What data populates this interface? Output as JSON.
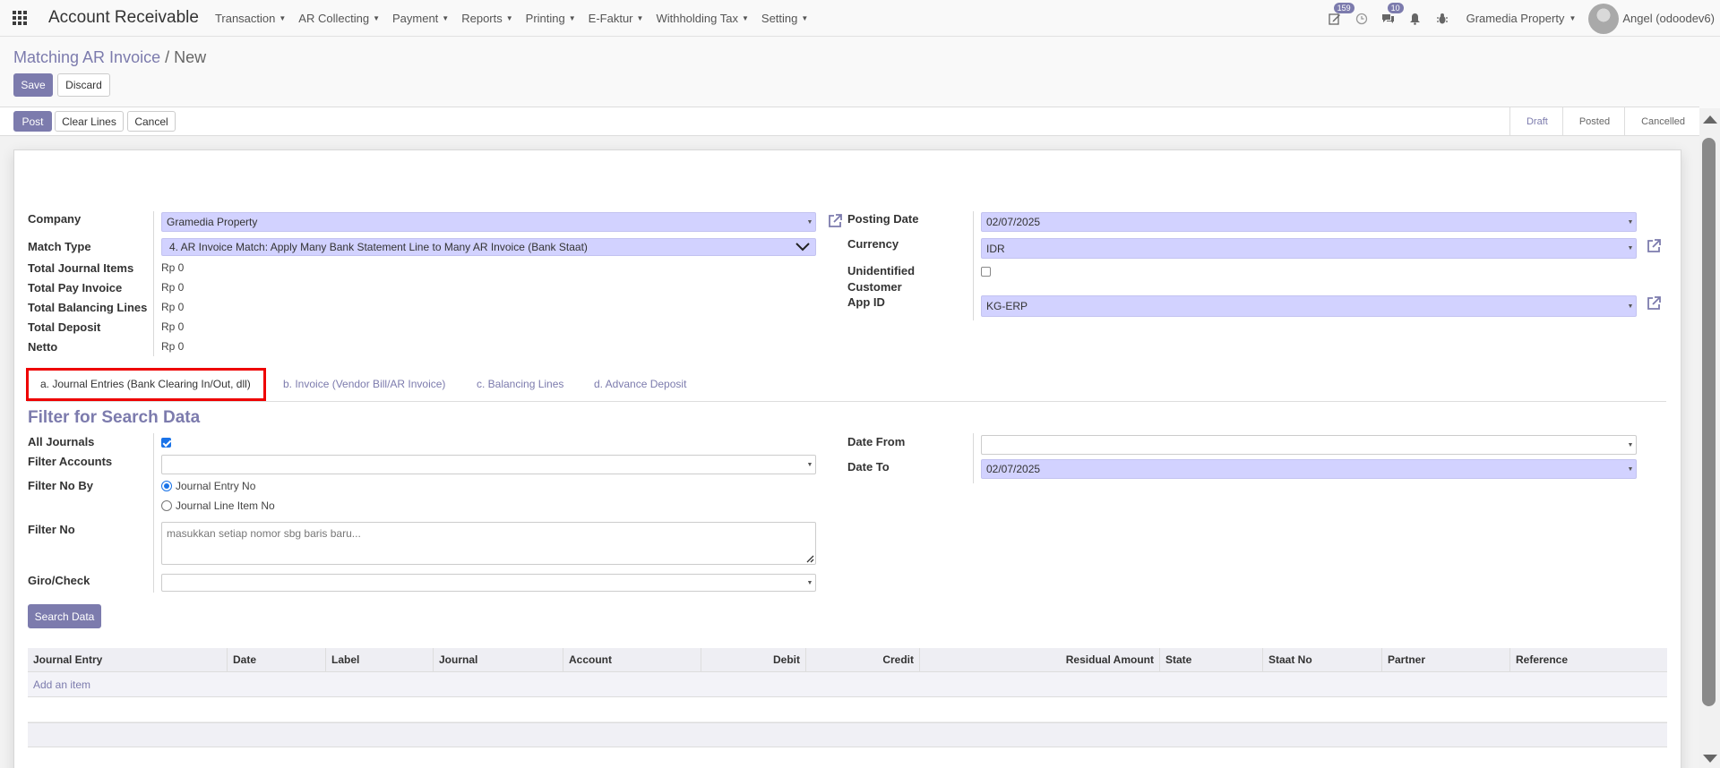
{
  "app": {
    "title": "Account Receivable"
  },
  "menu": [
    "Transaction",
    "AR Collecting",
    "Payment",
    "Reports",
    "Printing",
    "E-Faktur",
    "Withholding Tax",
    "Setting"
  ],
  "systray": {
    "activity_count": "159",
    "messages_count": "10",
    "company": "Gramedia Property",
    "user": "Angel (odoodev6)"
  },
  "breadcrumb": {
    "parent": "Matching AR Invoice",
    "separator": "/",
    "current": "New"
  },
  "actions": {
    "save": "Save",
    "discard": "Discard"
  },
  "header_buttons": {
    "post": "Post",
    "clear_lines": "Clear Lines",
    "cancel": "Cancel"
  },
  "stages": [
    {
      "label": "Draft",
      "active": true
    },
    {
      "label": "Posted",
      "active": false
    },
    {
      "label": "Cancelled",
      "active": false
    }
  ],
  "form": {
    "company": {
      "label": "Company",
      "value": "Gramedia Property"
    },
    "match_type": {
      "label": "Match Type",
      "value": "4. AR Invoice Match: Apply Many Bank Statement Line to Many AR Invoice (Bank Staat)"
    },
    "totals": [
      {
        "label": "Total Journal Items",
        "value": "Rp 0"
      },
      {
        "label": "Total Pay Invoice",
        "value": "Rp 0"
      },
      {
        "label": "Total Balancing Lines",
        "value": "Rp 0"
      },
      {
        "label": "Total Deposit",
        "value": "Rp 0"
      },
      {
        "label": "Netto",
        "value": "Rp 0"
      }
    ],
    "posting_date": {
      "label": "Posting Date",
      "value": "02/07/2025"
    },
    "currency": {
      "label": "Currency",
      "value": "IDR"
    },
    "unidentified_customer": {
      "label_line1": "Unidentified",
      "label_line2": "Customer",
      "checked": false
    },
    "app_id": {
      "label": "App ID",
      "value": "KG-ERP"
    }
  },
  "tabs": [
    {
      "label": "a. Journal Entries (Bank Clearing In/Out, dll)",
      "active": true
    },
    {
      "label": "b. Invoice (Vendor Bill/AR Invoice)",
      "active": false
    },
    {
      "label": "c. Balancing Lines",
      "active": false
    },
    {
      "label": "d. Advance Deposit",
      "active": false
    }
  ],
  "filter": {
    "title": "Filter for Search Data",
    "all_journals": {
      "label": "All Journals",
      "checked": true
    },
    "filter_accounts": {
      "label": "Filter Accounts",
      "value": ""
    },
    "filter_no_by": {
      "label": "Filter No By",
      "options": [
        "Journal Entry No",
        "Journal Line Item No"
      ],
      "selected": "Journal Entry No"
    },
    "filter_no": {
      "label": "Filter No",
      "placeholder": "masukkan setiap nomor sbg baris baru..."
    },
    "giro_check": {
      "label": "Giro/Check",
      "value": ""
    },
    "date_from": {
      "label": "Date From",
      "value": ""
    },
    "date_to": {
      "label": "Date To",
      "value": "02/07/2025"
    },
    "search_button": "Search Data"
  },
  "table": {
    "columns": [
      "Journal Entry",
      "Date",
      "Label",
      "Journal",
      "Account",
      "Debit",
      "Credit",
      "Residual Amount",
      "State",
      "Staat No",
      "Partner",
      "Reference"
    ],
    "add_item": "Add an item"
  },
  "colors": {
    "accent": "#7c7bad",
    "required_field": "#d2d2ff",
    "highlight_border": "#e00000"
  }
}
